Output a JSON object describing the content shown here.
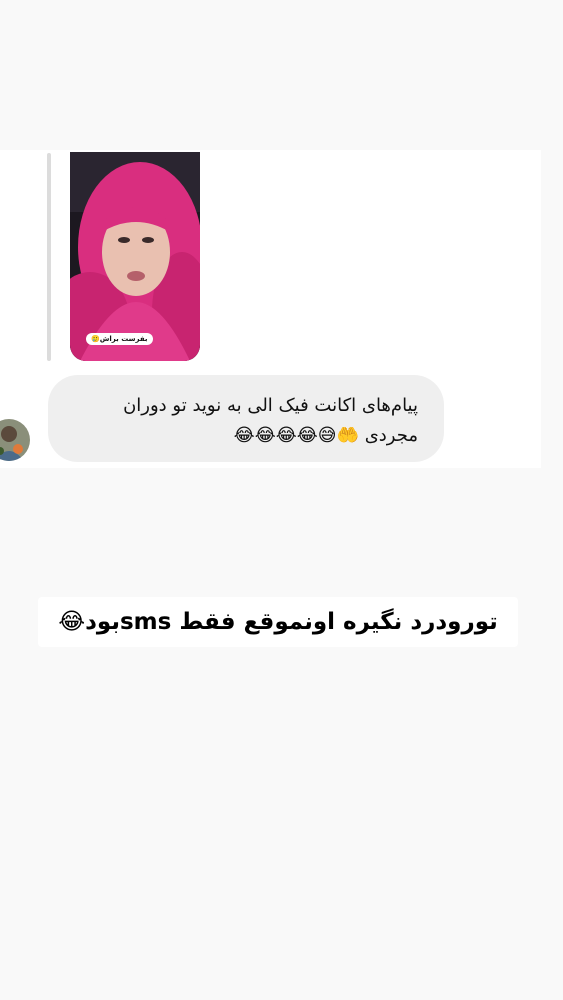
{
  "story_reply": {
    "sticker_text": "بفرست براش🥲"
  },
  "message": {
    "text": "پیام‌های اکانت فیک الی به نوید تو دوران مجردی 🤲😅😂😂😂😂"
  },
  "caption": {
    "text": "تورودرد نگیره اونموقع فقط smsبود😂"
  },
  "colors": {
    "background": "#f9f9f9",
    "panel": "#ffffff",
    "bubble": "#efefef",
    "scarf": "#d92e7f"
  },
  "icons": {
    "avatar": "profile-avatar"
  }
}
